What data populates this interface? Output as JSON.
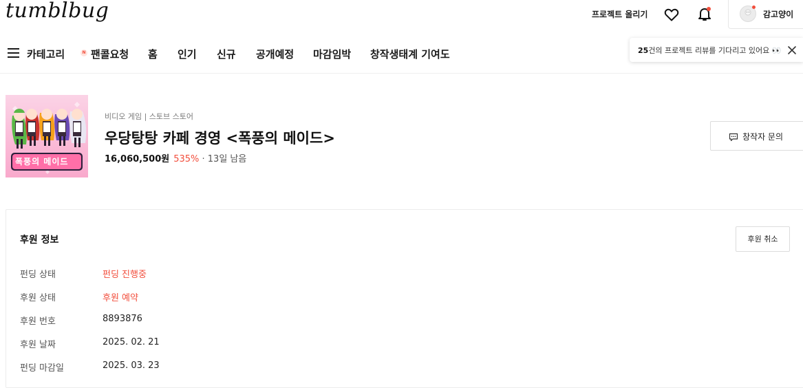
{
  "header": {
    "logo": "tumblbug",
    "upload_label": "프로젝트 올리기",
    "profile_name": "감고양이"
  },
  "nav": {
    "category_label": "카테고리",
    "items": [
      "팬콜요청",
      "홈",
      "인기",
      "신규",
      "공개예정",
      "마감임박",
      "창작생태계 기여도"
    ],
    "new_badge": "N"
  },
  "tooltip": {
    "count": "25",
    "text": "건의 프로젝트 리뷰를 기다리고 있어요 👀"
  },
  "project": {
    "category": "비디오 게임 | 스토브 스토어",
    "title": "우당탕탕 카페 경영 <폭풍의 메이드>",
    "amount": "16,060,500원",
    "percent": "535%",
    "remaining": " · 13일 남음",
    "thumb_caption": "폭풍의 메이드",
    "ask_label": "창작자 문의"
  },
  "sponsor": {
    "title": "후원 정보",
    "cancel_label": "후원 취소",
    "rows": [
      {
        "label": "펀딩 상태",
        "value": "펀딩 진행중"
      },
      {
        "label": "후원 상태",
        "value": "후원 예약"
      },
      {
        "label": "후원 번호",
        "value": "8893876"
      },
      {
        "label": "후원 날짜",
        "value": "2025. 02. 21"
      },
      {
        "label": "펀딩 마감일",
        "value": "2025. 03. 23"
      }
    ]
  },
  "colors": {
    "accent": "#f24e3c",
    "text": "#111111",
    "muted": "#7a7a7a",
    "border": "#dcdcdc"
  }
}
